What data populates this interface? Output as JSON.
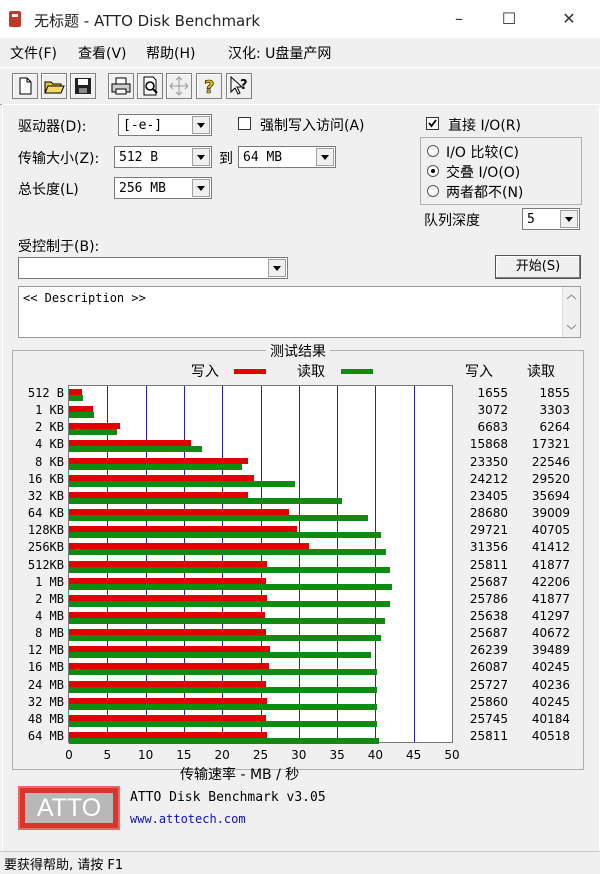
{
  "window": {
    "title": "无标题 - ATTO Disk Benchmark"
  },
  "menu": [
    "文件(F)",
    "查看(V)",
    "帮助(H)",
    "汉化: U盘量产网"
  ],
  "toolbar": [
    "new-icon",
    "open-icon",
    "save-icon",
    "print-icon",
    "print-preview-icon",
    "move-icon",
    "help-icon",
    "context-help-icon"
  ],
  "settings": {
    "drive_label": "驱动器(D):",
    "drive_value": "[-e-]",
    "force_write_label": "强制写入访问(A)",
    "transfer_label": "传输大小(Z):",
    "transfer_from": "512 B",
    "transfer_to_label": "到",
    "transfer_to": "64 MB",
    "total_label": "总长度(L)",
    "total_value": "256 MB",
    "direct_io_label": "直接 I/O(R)",
    "io_compare_label": "I/O 比较(C)",
    "overlap_io_label": "交叠 I/O(O)",
    "neither_label": "两者都不(N)",
    "queue_label": "队列深度",
    "queue_value": "5",
    "controlled_label": "受控制于(B):",
    "start_button": "开始(S)",
    "description": "<< Description >>"
  },
  "results": {
    "title": "测试结果",
    "legend_write": "写入",
    "legend_read": "读取",
    "col_write": "写入",
    "col_read": "读取",
    "xlabel": "传输速率 - MB / 秒"
  },
  "chart_data": {
    "type": "bar",
    "orientation": "horizontal",
    "categories": [
      "512 B",
      "1 KB",
      "2 KB",
      "4 KB",
      "8 KB",
      "16 KB",
      "32 KB",
      "64 KB",
      "128KB",
      "256KB",
      "512KB",
      "1 MB",
      "2 MB",
      "4 MB",
      "8 MB",
      "12 MB",
      "16 MB",
      "24 MB",
      "32 MB",
      "48 MB",
      "64 MB"
    ],
    "series": [
      {
        "name": "写入",
        "color": "#e00000",
        "values": [
          1655,
          3072,
          6683,
          15868,
          23350,
          24212,
          23405,
          28680,
          29721,
          31356,
          25811,
          25687,
          25786,
          25638,
          25687,
          26239,
          26087,
          25727,
          25860,
          25745,
          25811
        ]
      },
      {
        "name": "读取",
        "color": "#108a10",
        "values": [
          1855,
          3303,
          6264,
          17321,
          22546,
          29520,
          35694,
          39009,
          40705,
          41412,
          41877,
          42206,
          41877,
          41297,
          40672,
          39489,
          40245,
          40236,
          40245,
          40184,
          40518
        ]
      }
    ],
    "xlim": [
      0,
      50
    ],
    "xticks": [
      "0",
      "5",
      "10",
      "15",
      "20",
      "25",
      "30",
      "35",
      "40",
      "45",
      "50"
    ],
    "grid": true
  },
  "footer": {
    "logo": "ATTO",
    "version": "ATTO Disk Benchmark v3.05",
    "url": "www.attotech.com"
  },
  "status": "要获得帮助, 请按 F1"
}
